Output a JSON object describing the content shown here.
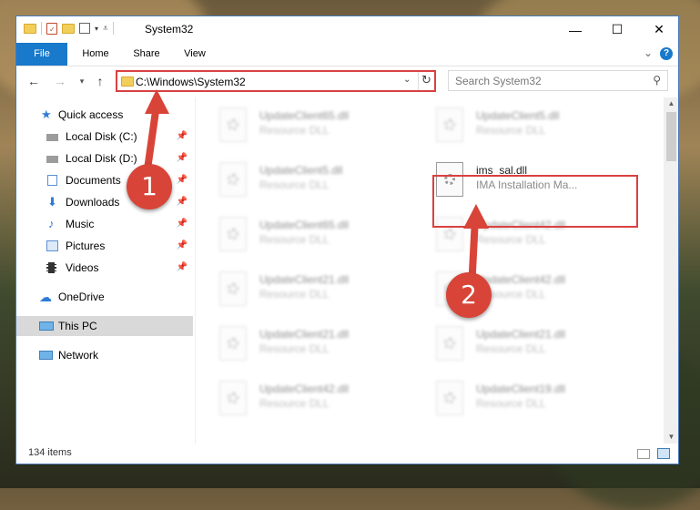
{
  "window": {
    "title": "System32",
    "minimize_glyph": "—",
    "maximize_glyph": "☐",
    "close_glyph": "✕"
  },
  "ribbon": {
    "tabs": [
      "File",
      "Home",
      "Share",
      "View"
    ],
    "help_glyph": "?",
    "expand_glyph": "⌄"
  },
  "address": {
    "path": "C:\\Windows\\System32",
    "search_placeholder": "Search System32"
  },
  "sidebar": {
    "quick_access": "Quick access",
    "items": [
      {
        "label": "Local Disk (C:)",
        "icon": "drive-icon"
      },
      {
        "label": "Local Disk (D:)",
        "icon": "drive-icon"
      },
      {
        "label": "Documents",
        "icon": "documents-icon"
      },
      {
        "label": "Downloads",
        "icon": "downloads-icon"
      },
      {
        "label": "Music",
        "icon": "music-icon"
      },
      {
        "label": "Pictures",
        "icon": "pictures-icon"
      },
      {
        "label": "Videos",
        "icon": "videos-icon"
      }
    ],
    "onedrive": "OneDrive",
    "this_pc": "This PC",
    "network": "Network"
  },
  "files": {
    "left_column": [
      {
        "name": "UpdateClient65.dll",
        "type": "Resource DLL"
      },
      {
        "name": "UpdateClient5.dll",
        "type": "Resource DLL"
      },
      {
        "name": "UpdateClient65.dll",
        "type": "Resource DLL"
      },
      {
        "name": "UpdateClient21.dll",
        "type": "Resource DLL"
      },
      {
        "name": "UpdateClient21.dll",
        "type": "Resource DLL"
      },
      {
        "name": "UpdateClient42.dll",
        "type": "Resource DLL"
      }
    ],
    "right_column": [
      {
        "name": "UpdateClient5.dll",
        "type": "Resource DLL"
      },
      {
        "name": "ims_sal.dll",
        "type": "IMA Installation Ma..."
      },
      {
        "name": "UpdateClient42.dll",
        "type": "Resource DLL"
      },
      {
        "name": "UpdateClient42.dll",
        "type": "Resource DLL"
      },
      {
        "name": "UpdateClient21.dll",
        "type": "Resource DLL"
      },
      {
        "name": "UpdateClient19.dll",
        "type": "Resource DLL"
      }
    ]
  },
  "status": {
    "item_count": "134 items"
  },
  "annotations": {
    "marker_1": "1",
    "marker_2": "2",
    "color": "#d84438"
  }
}
